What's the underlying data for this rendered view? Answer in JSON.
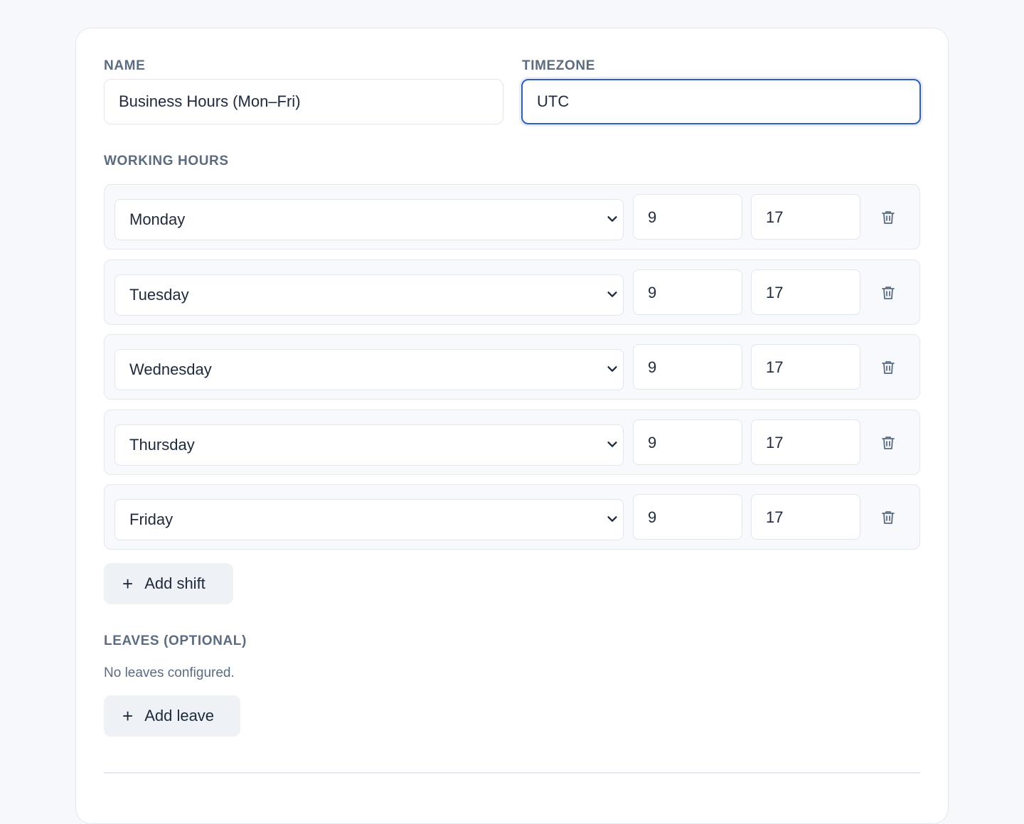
{
  "form": {
    "name_label": "NAME",
    "name_value": "Business Hours (Mon–Fri)",
    "timezone_label": "TIMEZONE",
    "timezone_value": "UTC",
    "working_hours_label": "WORKING HOURS",
    "shifts": [
      {
        "day": "Monday",
        "start": "9",
        "end": "17"
      },
      {
        "day": "Tuesday",
        "start": "9",
        "end": "17"
      },
      {
        "day": "Wednesday",
        "start": "9",
        "end": "17"
      },
      {
        "day": "Thursday",
        "start": "9",
        "end": "17"
      },
      {
        "day": "Friday",
        "start": "9",
        "end": "17"
      }
    ],
    "add_shift_label": "Add shift",
    "leaves_label": "LEAVES (OPTIONAL)",
    "leaves_empty_text": "No leaves configured.",
    "add_leave_label": "Add leave"
  },
  "icons": {
    "select": "chevron-down-icon",
    "delete": "trash-icon",
    "add": "plus-icon"
  },
  "colors": {
    "focus_border": "#2f5fb8",
    "label": "#5b6b80",
    "button_bg": "#eef2f7"
  }
}
